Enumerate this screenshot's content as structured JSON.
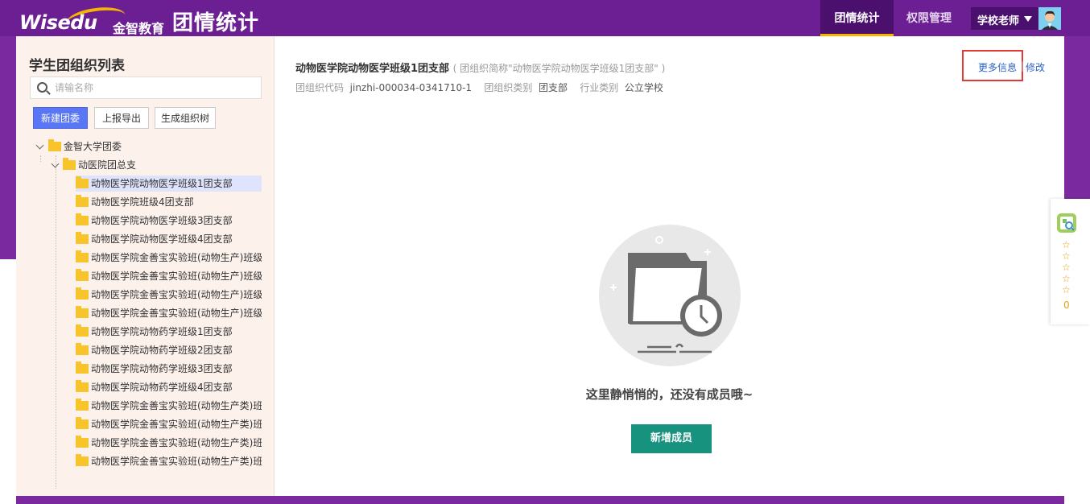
{
  "header": {
    "logo_text": "Wisedu",
    "logo_cn": "金智教育",
    "app_title": "团情统计",
    "tabs": [
      {
        "label": "团情统计",
        "active": true
      },
      {
        "label": "权限管理",
        "active": false
      }
    ],
    "user_name": "学校老师"
  },
  "sidebar": {
    "title": "学生团组织列表",
    "search_placeholder": "请输名称",
    "buttons": {
      "new": "新建团委",
      "export": "上报导出",
      "tree": "生成组织树"
    },
    "root": "金智大学团委",
    "branch": "动医院团总支",
    "items": [
      "动物医学院动物医学班级1团支部",
      "动物医学院班级4团支部",
      "动物医学院动物医学班级3团支部",
      "动物医学院动物医学班级4团支部",
      "动物医学院金善宝实验班(动物生产)班级",
      "动物医学院金善宝实验班(动物生产)班级",
      "动物医学院金善宝实验班(动物生产)班级",
      "动物医学院金善宝实验班(动物生产)班级",
      "动物医学院动物药学班级1团支部",
      "动物医学院动物药学班级2团支部",
      "动物医学院动物药学班级3团支部",
      "动物医学院动物药学班级4团支部",
      "动物医学院金善宝实验班(动物生产类)班",
      "动物医学院金善宝实验班(动物生产类)班",
      "动物医学院金善宝实验班(动物生产类)班",
      "动物医学院金善宝实验班(动物生产类)班"
    ]
  },
  "main": {
    "org_name": "动物医学院动物医学班级1团支部",
    "org_short": "( 团组织简称\"动物医学院动物医学班级1团支部\" )",
    "code_label": "团组织代码",
    "code_value": "jinzhi-000034-0341710-1",
    "type_label": "团组织类别",
    "type_value": "团支部",
    "industry_label": "行业类别",
    "industry_value": "公立学校",
    "more_info": "更多信息",
    "separator": "|",
    "edit": "修改",
    "empty_message": "这里静悄悄的，还没有成员哦~",
    "add_member": "新增成员"
  },
  "rating": {
    "count": "0",
    "star": "☆"
  }
}
